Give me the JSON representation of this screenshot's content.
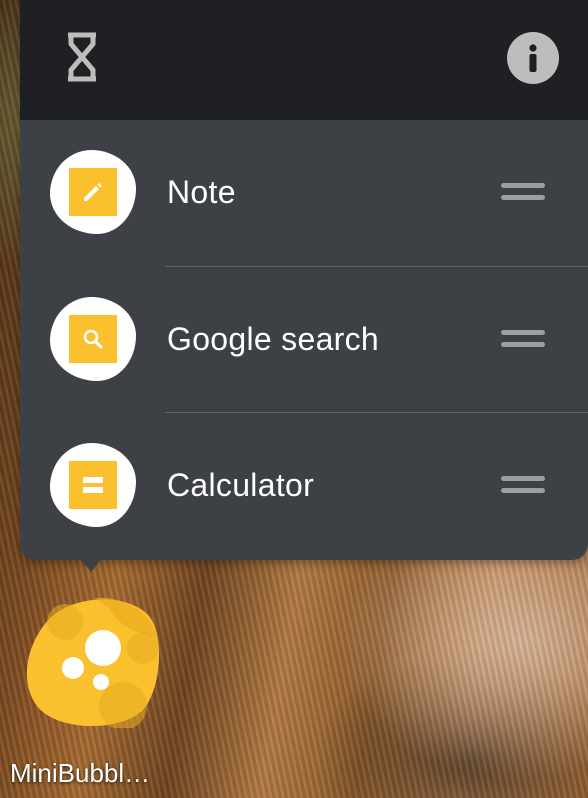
{
  "header": {
    "left_icon": "hourglass-icon",
    "right_icon": "info-icon"
  },
  "menu": {
    "items": [
      {
        "label": "Note",
        "icon": "pencil-icon"
      },
      {
        "label": "Google search",
        "icon": "search-icon"
      },
      {
        "label": "Calculator",
        "icon": "calculator-icon"
      }
    ]
  },
  "bubble": {
    "label": "MiniBubbl…",
    "color": "#fbc02d"
  },
  "colors": {
    "panel": "#3d4044",
    "header": "#1f2023",
    "accent": "#fbc02d"
  }
}
